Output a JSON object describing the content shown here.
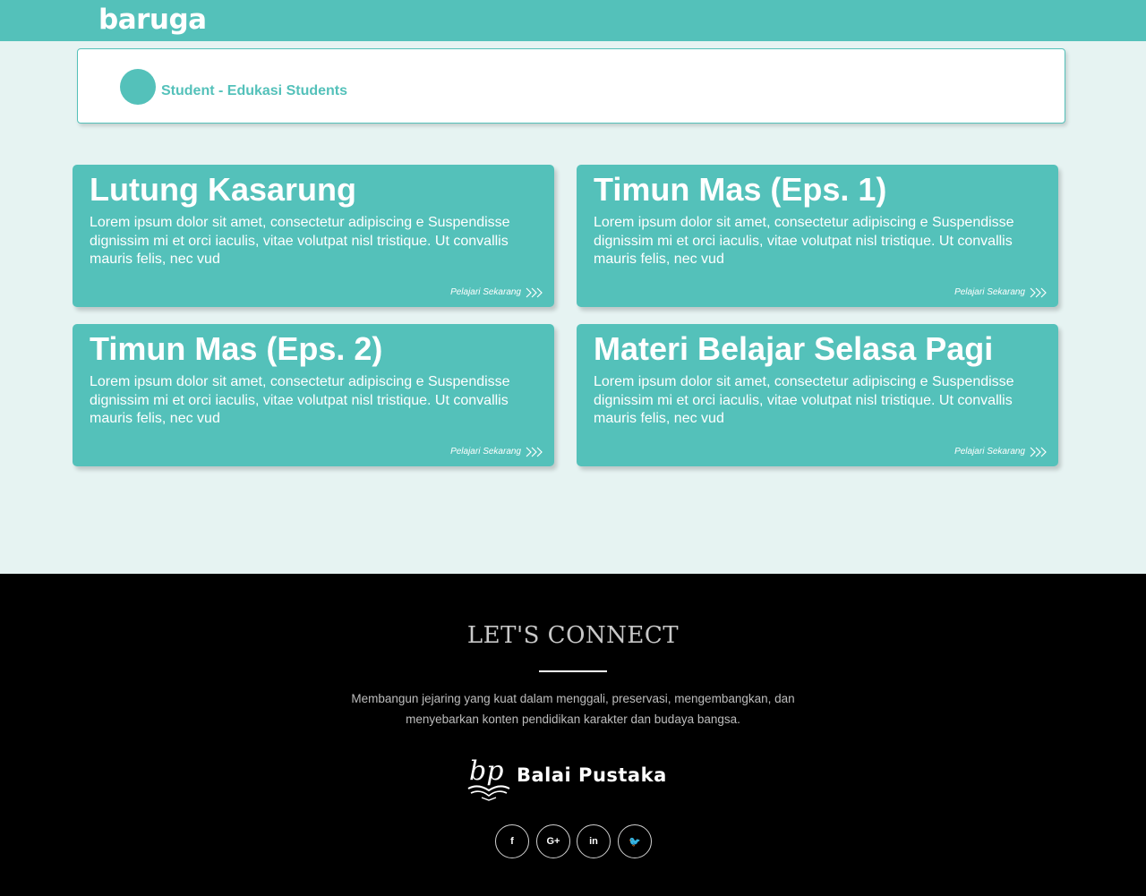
{
  "header": {
    "logo_text": "baruga",
    "bg_color": "#54c1ba"
  },
  "profile": {
    "name": "Student - Edukasi Students",
    "avatar_icon": "user-avatar",
    "accent_color": "#54c1ba"
  },
  "cards": [
    {
      "title": "Lutung Kasarung",
      "description": "Lorem ipsum dolor sit amet, consectetur adipiscing e Suspendisse dignissim mi et orci iaculis, vitae volutpat nisl tristique. Ut convallis mauris felis, nec vud",
      "link_label": "Pelajari Sekarang",
      "link_icon": "triple-chevron-right-icon"
    },
    {
      "title": "Timun Mas (Eps. 1)",
      "description": "Lorem ipsum dolor sit amet, consectetur adipiscing e Suspendisse dignissim mi et orci iaculis, vitae volutpat nisl tristique. Ut convallis mauris felis, nec vud",
      "link_label": "Pelajari Sekarang",
      "link_icon": "triple-chevron-right-icon"
    },
    {
      "title": "Timun Mas (Eps. 2)",
      "description": "Lorem ipsum dolor sit amet, consectetur adipiscing e Suspendisse dignissim mi et orci iaculis, vitae volutpat nisl tristique. Ut convallis mauris felis, nec vud",
      "link_label": "Pelajari Sekarang",
      "link_icon": "triple-chevron-right-icon"
    },
    {
      "title": "Materi Belajar Selasa Pagi",
      "description": "Lorem ipsum dolor sit amet, consectetur adipiscing e Suspendisse dignissim mi et orci iaculis, vitae volutpat nisl tristique. Ut convallis mauris felis, nec vud",
      "link_label": "Pelajari Sekarang",
      "link_icon": "triple-chevron-right-icon"
    }
  ],
  "footer": {
    "title": "LET'S CONNECT",
    "mission": "Membangun jejaring yang kuat dalam menggali, preservasi, mengembangkan, dan menyebarkan konten pendidikan karakter dan budaya bangsa.",
    "partner_logo_text": "Balai Pustaka",
    "partner_logo_mark": "bp",
    "social": [
      {
        "name": "facebook-icon",
        "glyph": "f"
      },
      {
        "name": "google-plus-icon",
        "glyph": "G+"
      },
      {
        "name": "linkedin-icon",
        "glyph": "in"
      },
      {
        "name": "twitter-icon",
        "glyph": "🐦"
      }
    ]
  }
}
